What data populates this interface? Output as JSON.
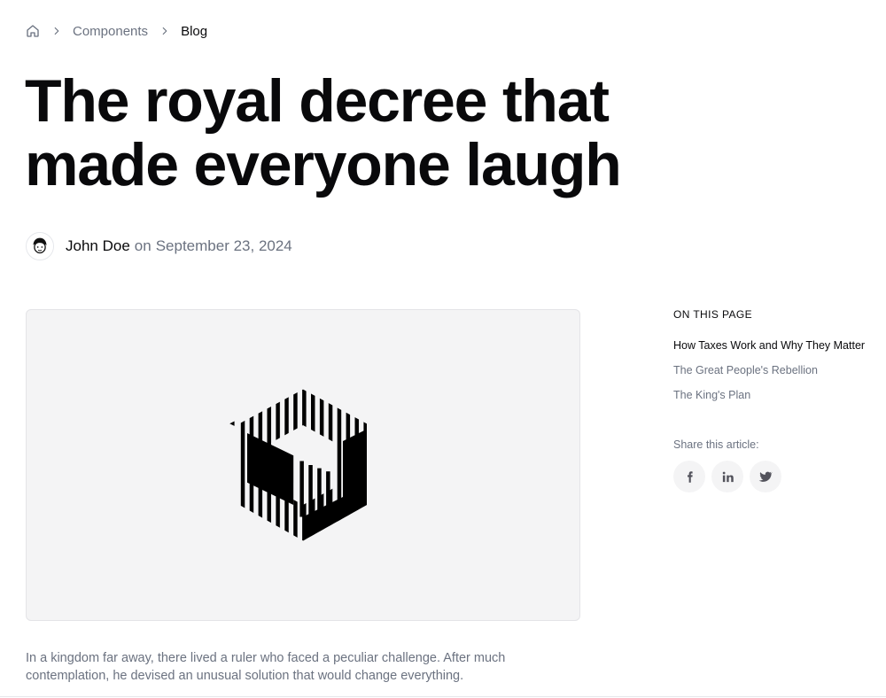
{
  "breadcrumb": {
    "home_icon": "home-icon",
    "separator_icon": "chevron-right-icon",
    "items": [
      {
        "label": "Components"
      },
      {
        "label": "Blog"
      }
    ]
  },
  "article": {
    "title": "The royal decree that made everyone laugh",
    "author": "John Doe",
    "on_word": "on",
    "date": "September 23, 2024",
    "avatar_icon": "avatar-illustration",
    "hero_image_icon": "abstract-striped-logo",
    "intro": "In a kingdom far away, there lived a ruler who faced a peculiar challenge. After much contemplation, he devised an unusual solution that would change everything."
  },
  "toc": {
    "heading": "ON THIS PAGE",
    "items": [
      {
        "label": "How Taxes Work and Why They Matter",
        "active": true
      },
      {
        "label": "The Great People's Rebellion",
        "active": false
      },
      {
        "label": "The King's Plan",
        "active": false
      }
    ]
  },
  "share": {
    "label": "Share this article:",
    "buttons": [
      {
        "name": "facebook",
        "icon": "facebook-icon"
      },
      {
        "name": "linkedin",
        "icon": "linkedin-icon"
      },
      {
        "name": "twitter",
        "icon": "twitter-icon"
      }
    ]
  },
  "colors": {
    "text": "#09090b",
    "muted": "#6b7280",
    "surface": "#f4f4f5",
    "border": "#e4e4e7"
  }
}
